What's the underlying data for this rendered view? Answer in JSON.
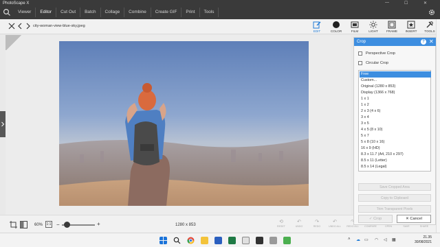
{
  "app": {
    "title": "PhotoScape X",
    "win_minimize": "—",
    "win_maximize": "☐",
    "win_close": "✕"
  },
  "menu": [
    {
      "label": "Viewer"
    },
    {
      "label": "Editor"
    },
    {
      "label": "Cut Out"
    },
    {
      "label": "Batch"
    },
    {
      "label": "Collage"
    },
    {
      "label": "Combine"
    },
    {
      "label": "Create GIF"
    },
    {
      "label": "Print"
    },
    {
      "label": "Tools"
    }
  ],
  "file": {
    "name": "city-woman-view-blue-sky.jpeg"
  },
  "tools": [
    {
      "label": "EDIT"
    },
    {
      "label": "COLOR"
    },
    {
      "label": "FILM"
    },
    {
      "label": "LIGHT"
    },
    {
      "label": "FRAME"
    },
    {
      "label": "INSERT"
    },
    {
      "label": "TOOLS"
    }
  ],
  "status": {
    "zoom": "60%",
    "one_to_one": "1:1",
    "zoom_level": 0.15,
    "dimensions": "1280 x 853"
  },
  "actions": [
    {
      "label": "RESET"
    },
    {
      "label": "UNDO"
    },
    {
      "label": "REDO"
    },
    {
      "label": "UNDO ALL"
    },
    {
      "label": "REDO ALL"
    },
    {
      "label": "COMPARE"
    },
    {
      "label": "OPEN"
    },
    {
      "label": "SAVE"
    },
    {
      "label": "SHARE"
    }
  ],
  "crop": {
    "title": "Crop",
    "help": "?",
    "close": "✕",
    "perspective": "Perspective Crop",
    "circular": "Circular Crop",
    "options": [
      "Free",
      "Custom...",
      "Original (1280 x 853)",
      "Display (1366 x 768)",
      "1 x 1",
      "1 x 2",
      "2 x 3 (4 x 6)",
      "3 x 4",
      "3 x 5",
      "4 x 5 (8 x 10)",
      "5 x 7",
      "5 x 8 (10 x 16)",
      "16 x 9 (HD)",
      "8.3 x 11.7 (A4, 210 x 297)",
      "8.5 x 11 (Letter)",
      "8.5 x 14 (Legal)"
    ],
    "save_cropped": "Save Cropped Area",
    "copy_clipboard": "Copy to Clipboard",
    "trim": "Trim Transparent Pixels",
    "ok": "Crop",
    "ok_check": "✓",
    "cancel": "Cancel",
    "cancel_x": "✕"
  },
  "clock": {
    "time": "21.35",
    "date": "30/08/2021"
  },
  "colors": {
    "accent": "#3d8ee0",
    "appbar": "#3a3a3a"
  }
}
